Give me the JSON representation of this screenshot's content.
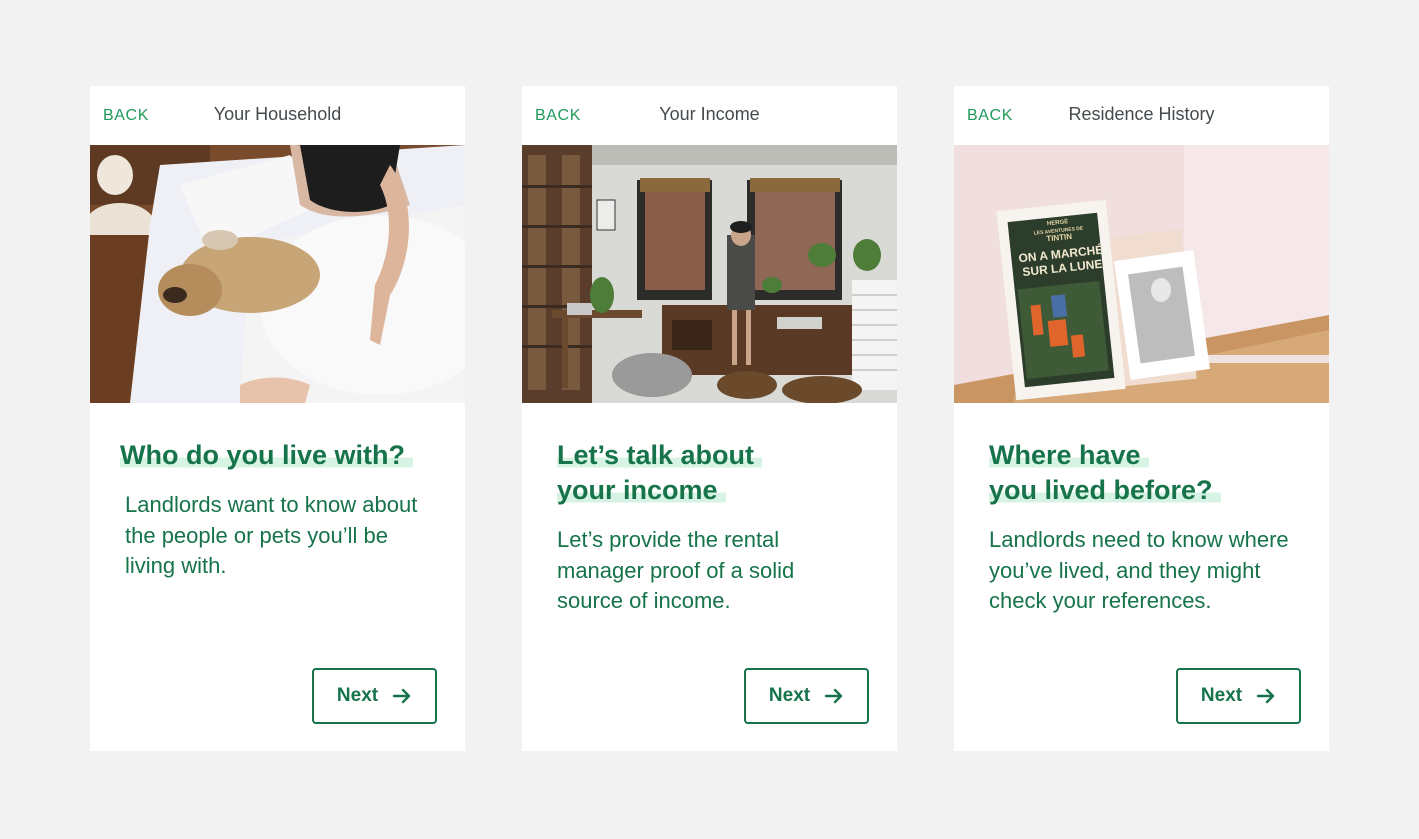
{
  "colors": {
    "page_background": "#f2f2f2",
    "card_background": "#ffffff",
    "accent_green": "#16734a",
    "back_link_green": "#1f9a5b",
    "heading_highlight": "#d7f3e3",
    "title_gray": "#444a4d"
  },
  "cards": [
    {
      "back_label": "BACK",
      "title": "Your Household",
      "heading_lines": [
        "Who do you live with?"
      ],
      "description": "Landlords want to know about the people or pets you’ll be living with.",
      "next_label": "Next",
      "next_icon": "arrow-right-icon",
      "photo": "woman-in-bed-with-pug-photo"
    },
    {
      "back_label": "BACK",
      "title": "Your Income",
      "heading_lines": [
        "Let’s talk about",
        "your income"
      ],
      "description": "Let’s provide the rental manager proof of a solid source of income.",
      "next_label": "Next",
      "next_icon": "arrow-right-icon",
      "photo": "woman-in-apartment-by-window-photo"
    },
    {
      "back_label": "BACK",
      "title": "Residence History",
      "heading_lines": [
        "Where have",
        "you lived before?"
      ],
      "description": "Landlords need to know where you’ve lived, and they might check your references.",
      "next_label": "Next",
      "next_icon": "arrow-right-icon",
      "photo": "framed-posters-on-floor-photo",
      "poster_text": [
        "HERGÉ",
        "LES AVENTURES DE",
        "TINTIN",
        "ON A MARCHÉ",
        "SUR LA LUNE"
      ]
    }
  ]
}
